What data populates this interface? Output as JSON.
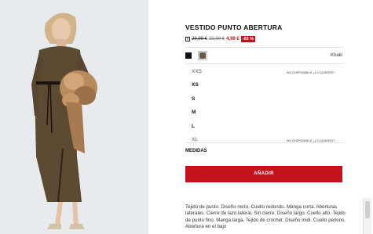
{
  "product": {
    "title": "VESTIDO PUNTO ABERTURA",
    "price_info_icon": "i",
    "price_original": "29,99 €",
    "price_previous": "20,99 €",
    "price_current": "4,99 €",
    "discount": "-83 %"
  },
  "colors": {
    "swatches": [
      {
        "name": "black",
        "hex": "#111111"
      },
      {
        "name": "khaki",
        "hex": "#6a5a44"
      }
    ],
    "selected_label": "Khaki"
  },
  "sizes": [
    {
      "label": "XXS",
      "available": false,
      "note": "NO DISPONIBLE ¿LO QUIERO?"
    },
    {
      "label": "XS",
      "available": true,
      "note": ""
    },
    {
      "label": "S",
      "available": true,
      "note": ""
    },
    {
      "label": "M",
      "available": true,
      "note": ""
    },
    {
      "label": "L",
      "available": true,
      "note": ""
    },
    {
      "label": "XL",
      "available": false,
      "note": "NO DISPONIBLE ¿LO QUIERO?"
    }
  ],
  "measures_label": "MEDIDAS",
  "add_button_label": "AÑADIR",
  "description": "Tejido de punto. Diseño recto. Cuello redondo. Manga corta. Aberturas laterales. Cierre de lazo lateral. Sin cierre. Diseño largo. Cuello alto. Tejido de punto fino. Manga larga. Tejido de crochet. Diseño midi. Cuello perkins. Abertura en el bajo",
  "accent_color": "#c3121c"
}
